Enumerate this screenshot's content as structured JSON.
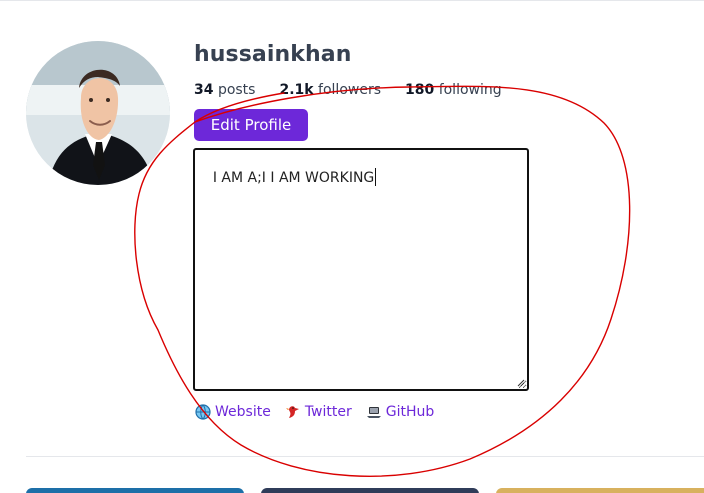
{
  "profile": {
    "username": "hussainkhan",
    "stats": [
      {
        "value": "34",
        "label": "posts"
      },
      {
        "value": "2.1k",
        "label": "followers"
      },
      {
        "value": "180",
        "label": "following"
      }
    ],
    "edit_button_label": "Edit Profile",
    "bio_text": "I AM A;I I AM WORKING",
    "links": [
      {
        "label": "Website",
        "icon": "globe-icon"
      },
      {
        "label": "Twitter",
        "icon": "bird-icon"
      },
      {
        "label": "GitHub",
        "icon": "laptop-icon"
      }
    ]
  },
  "colors": {
    "accent": "#6d28d9",
    "annotation": "#d90000",
    "text": "#374151",
    "divider": "#e5e7eb"
  }
}
